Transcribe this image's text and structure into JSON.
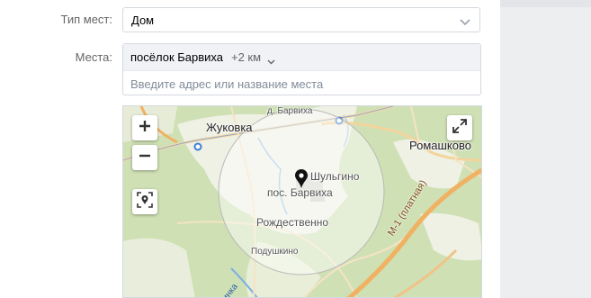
{
  "form": {
    "place_type_label": "Тип мест:",
    "place_type_value": "Дом",
    "places_label": "Места:",
    "selected_place": "посёлок Барвиха",
    "radius": "+2 км",
    "address_placeholder": "Введите адрес или название места"
  },
  "map": {
    "labels": {
      "zhukovka": "Жуковка",
      "d_barvikha": "д. Барвиха",
      "romashkovo": "Ромашково",
      "shulgino": "Шульгино",
      "pos_barvikha": "пос. Барвиха",
      "rozhdestvenno": "Рождественно",
      "podushkino": "Подушкино",
      "road_m1": "М-1 (платная)",
      "river_partial": "инка"
    },
    "icons": {
      "zoom_in": "plus-icon",
      "zoom_out": "minus-icon",
      "locate": "locate-icon",
      "fullscreen": "expand-icon",
      "pin": "map-pin-icon",
      "select_arrow": "chevron-down-icon"
    },
    "colors": {
      "forest": "#c9dcae",
      "open_area": "#eef0e6",
      "road_major": "#f0b262",
      "radius_circle": "rgba(255,255,255,0.45)",
      "pin": "#111111"
    }
  }
}
